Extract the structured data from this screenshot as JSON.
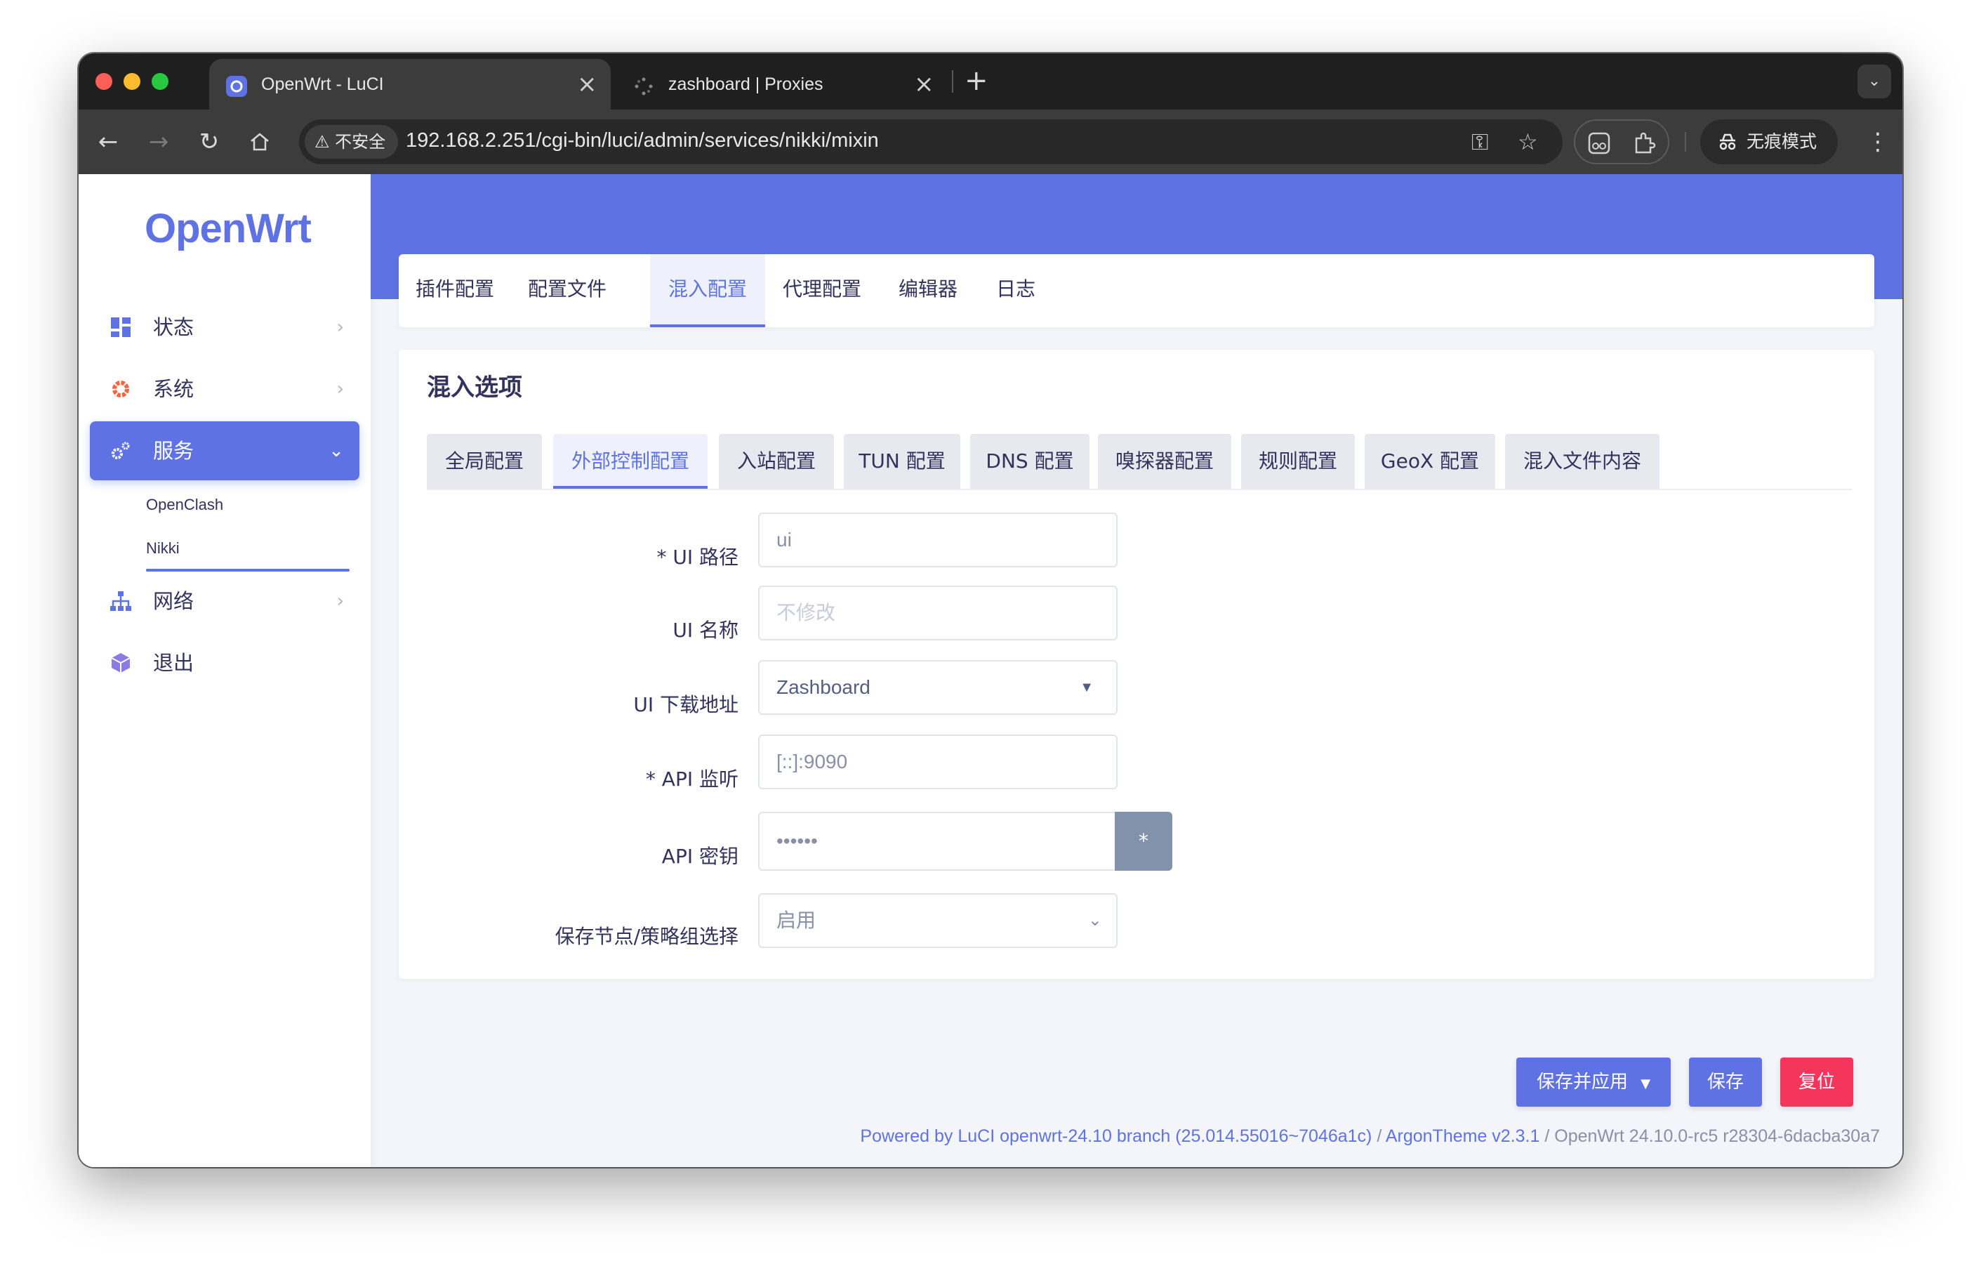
{
  "browser": {
    "tabs": [
      {
        "title": "OpenWrt - LuCI",
        "active": true
      },
      {
        "title": "zashboard | Proxies",
        "active": false
      }
    ],
    "new_tab": "+",
    "security_label": "不安全",
    "url": "192.168.2.251/cgi-bin/luci/admin/services/nikki/mixin",
    "incognito_label": "无痕模式"
  },
  "sidebar": {
    "brand": "OpenWrt",
    "items": [
      {
        "label": "状态",
        "icon": "dashboard-icon"
      },
      {
        "label": "系统",
        "icon": "gear-icon"
      },
      {
        "label": "服务",
        "icon": "cogs-icon",
        "active": true
      },
      {
        "label": "网络",
        "icon": "network-icon"
      },
      {
        "label": "退出",
        "icon": "cube-icon"
      }
    ],
    "subitems": [
      "OpenClash",
      "Nikki"
    ]
  },
  "page_tabs": [
    "插件配置",
    "配置文件",
    "混入配置",
    "代理配置",
    "编辑器",
    "日志"
  ],
  "section": {
    "title": "混入选项",
    "tabs": [
      "全局配置",
      "外部控制配置",
      "入站配置",
      "TUN 配置",
      "DNS 配置",
      "嗅探器配置",
      "规则配置",
      "GeoX 配置",
      "混入文件内容"
    ]
  },
  "form": {
    "fields": [
      {
        "label": "UI 路径",
        "required": true,
        "value": "ui"
      },
      {
        "label": "UI 名称",
        "required": false,
        "placeholder": "不修改"
      },
      {
        "label": "UI 下载地址",
        "required": false,
        "value": "Zashboard"
      },
      {
        "label": "API 监听",
        "required": true,
        "value": "[::]:9090"
      },
      {
        "label": "API 密钥",
        "required": false,
        "value": "••••••",
        "reveal": "*"
      },
      {
        "label": "保存节点/策略组选择",
        "required": false,
        "value": "启用"
      }
    ]
  },
  "actions": {
    "save_apply": "保存并应用",
    "save": "保存",
    "reset": "复位"
  },
  "footer": {
    "powered": "Powered by LuCI openwrt-24.10 branch (25.014.55016~7046a1c)",
    "sep1": " / ",
    "theme": "ArgonTheme v2.3.1",
    "sep2": " / ",
    "version": "OpenWrt 24.10.0-rc5 r28304-6dacba30a7"
  },
  "colors": {
    "accent": "#5e72e4",
    "danger": "#f5365c",
    "text": "#32325d"
  }
}
